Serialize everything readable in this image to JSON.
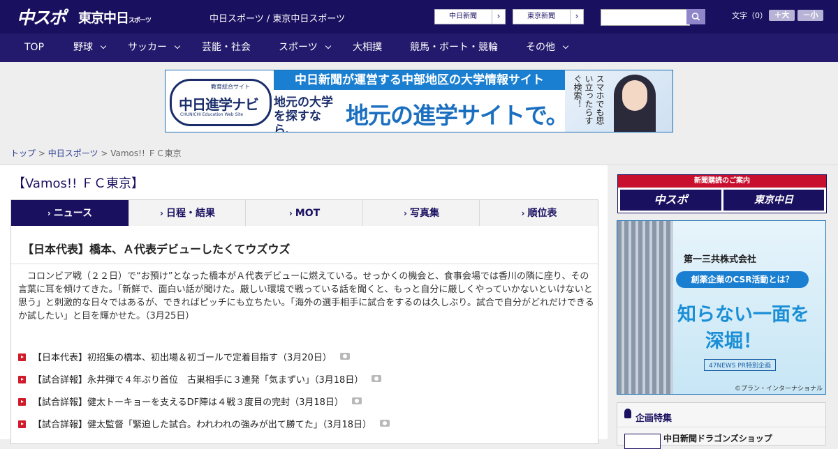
{
  "header": {
    "logo_main": "中スポ",
    "logo_sub": "東京中日",
    "logo_sub_small": "スポーツ",
    "site_title": "中日スポーツ / 東京中日スポーツ",
    "links": [
      {
        "label": "中日新聞",
        "arrow": "›"
      },
      {
        "label": "東京新聞",
        "arrow": "›"
      }
    ],
    "search": {
      "placeholder": "",
      "button_icon": "search-icon"
    },
    "font_size": {
      "label": "文字（0）",
      "bigger": "＋大",
      "smaller": "－小"
    }
  },
  "nav": {
    "items": [
      {
        "label": "TOP",
        "has_dropdown": false
      },
      {
        "label": "野球",
        "has_dropdown": true
      },
      {
        "label": "サッカー",
        "has_dropdown": true
      },
      {
        "label": "芸能・社会",
        "has_dropdown": false
      },
      {
        "label": "スポーツ",
        "has_dropdown": true
      },
      {
        "label": "大相撲",
        "has_dropdown": false
      },
      {
        "label": "競馬・ボート・競輪",
        "has_dropdown": false
      },
      {
        "label": "その他",
        "has_dropdown": true
      }
    ]
  },
  "banner": {
    "logo_top": "教育総合サイト",
    "logo_main": "中日進学ナビ",
    "logo_bottom": "CHUNICHI Education Web Site",
    "headline": "中日新聞が運営する中部地区の大学情報サイト",
    "left_text": "地元の大学を探すなら、",
    "big_text": "地元の進学サイトで。",
    "vertical_text": "スマホでも思い立ったらすぐ検索！"
  },
  "breadcrumb": {
    "items": [
      "トップ",
      "中日スポーツ"
    ],
    "separator": ">",
    "current": "Vamos!!  ＦＣ東京"
  },
  "page": {
    "title": "【Vamos!!  ＦＣ東京】",
    "tabs": [
      {
        "label": "ニュース",
        "active": true
      },
      {
        "label": "日程・結果",
        "active": false
      },
      {
        "label": "MOT",
        "active": false
      },
      {
        "label": "写真集",
        "active": false
      },
      {
        "label": "順位表",
        "active": false
      }
    ],
    "tab_marker": "›"
  },
  "article": {
    "title": "【日本代表】橋本、Ａ代表デビューしたくてウズウズ",
    "body": "コロンビア戦（２２日）で“お預け”となった橋本がＡ代表デビューに燃えている。せっかくの機会と、食事会場では香川の隣に座り、その言葉に耳を傾けてきた。「新鮮で、面白い話が聞けた。厳しい環境で戦っている話を聞くと、もっと自分に厳しくやっていかないといけないと思う」と刺激的な日々ではあるが、できればピッチにも立ちたい。「海外の選手相手に試合をするのは久しぶり。試合で自分がどれだけできるか試したい」と目を輝かせた。（3月25日）"
  },
  "news_list": [
    {
      "title": "【日本代表】初招集の橋本、初出場＆初ゴールで定着目指す（3月20日）",
      "has_photo": true
    },
    {
      "title": "【試合詳報】永井弾で４年ぶり首位　古巣相手に３連発「気まずい」（3月18日）",
      "has_photo": true
    },
    {
      "title": "【試合詳報】健太トーキョーを支えるDF陣は４戦３度目の完封（3月18日）",
      "has_photo": true
    },
    {
      "title": "【試合詳報】健太監督「緊迫した試合。われわれの強みが出て勝てた」（3月18日）",
      "has_photo": true
    }
  ],
  "sidebar": {
    "subscribe": {
      "title": "新聞購読のご案内",
      "left": "中スポ",
      "right": "東京中日"
    },
    "ad": {
      "company": "第一三共株式会社",
      "csr": "創薬企業のCSR活動とは？",
      "big1": "知らない一面を",
      "big2": "深堀！",
      "label": "47NEWS PR特別企画",
      "copyright": "©プラン・インターナショナル"
    },
    "feature": {
      "title": "企画特集",
      "item": "中日新聞ドラゴンズショップ"
    }
  },
  "colors": {
    "header_bg": "#1a1060",
    "nav_bg": "#241a6d",
    "accent_red": "#c8102e",
    "link": "#2a3b8f"
  }
}
